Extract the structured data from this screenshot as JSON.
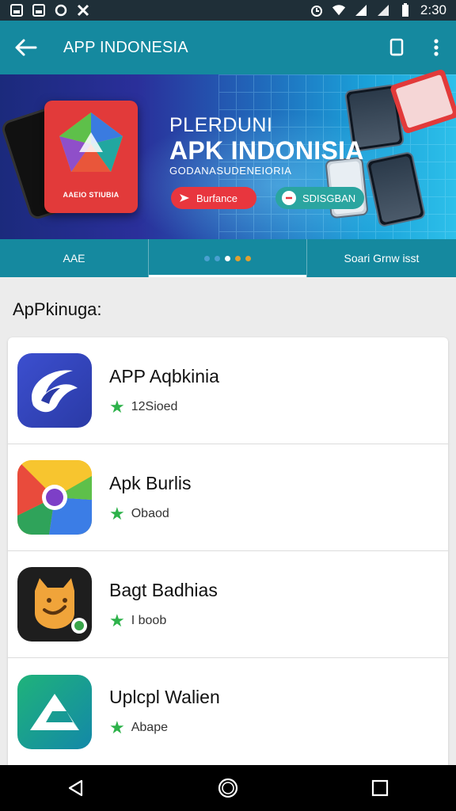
{
  "status_bar": {
    "time": "2:30",
    "left_icons": [
      "gallery-icon",
      "gallery-icon",
      "notification-icon",
      "bug-icon"
    ],
    "right_icons": [
      "alarm-icon",
      "wifi-icon",
      "signal-icon",
      "signal-icon",
      "battery-icon"
    ]
  },
  "app_bar": {
    "title": "APP INDONESIA",
    "back_icon": "arrow-left-icon",
    "actions": [
      "bookmark-icon",
      "more-vert-icon"
    ]
  },
  "banner": {
    "line1": "PLERDUNI",
    "line2": "APK INDONISIA",
    "line3": "GODANASUDENEIORIA",
    "card_label": "AAEIO STIUBIA",
    "button_primary": "Burfance",
    "button_secondary": "SDISGBAN"
  },
  "tabs": {
    "left": "AAE",
    "right": "Soari Grnw isst",
    "dot_colors": [
      "#4aa0d0",
      "#4aa0d0",
      "#ffffff",
      "#e0a030",
      "#e0a030"
    ]
  },
  "section": {
    "title": "ApPkinuga:"
  },
  "apps": [
    {
      "name": "APP Aqbkinia",
      "meta": "12Sioed",
      "icon": "swirl-app-icon"
    },
    {
      "name": "Apk Burlis",
      "meta": "Obaod",
      "icon": "chrome-like-app-icon"
    },
    {
      "name": "Bagt Badhias",
      "meta": "I boob",
      "icon": "cat-app-icon"
    },
    {
      "name": "Uplcpl Walien",
      "meta": "Abape",
      "icon": "arrow-app-icon"
    }
  ],
  "nav": [
    "back-icon",
    "home-icon",
    "recents-icon"
  ],
  "colors": {
    "primary": "#15899f",
    "star": "#2db24a",
    "banner_red": "#e8363e"
  }
}
